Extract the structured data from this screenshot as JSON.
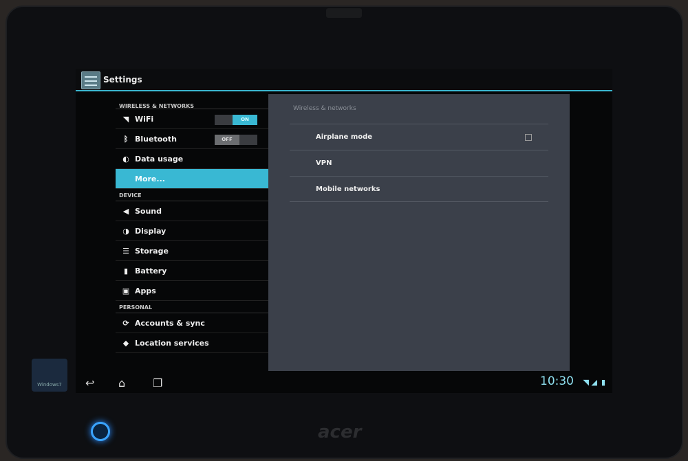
{
  "device": {
    "brand": "acer",
    "desktop_tile": "Windows7"
  },
  "action_bar": {
    "title": "Settings"
  },
  "left_pane": {
    "sections": [
      {
        "header": "WIRELESS & NETWORKS",
        "items": [
          {
            "label": "WiFi",
            "icon": "wifi-icon",
            "toggle": "ON"
          },
          {
            "label": "Bluetooth",
            "icon": "bluetooth-icon",
            "toggle": "OFF"
          },
          {
            "label": "Data usage",
            "icon": "data-usage-icon"
          },
          {
            "label": "More...",
            "selected": true
          }
        ]
      },
      {
        "header": "DEVICE",
        "items": [
          {
            "label": "Sound",
            "icon": "sound-icon"
          },
          {
            "label": "Display",
            "icon": "display-icon"
          },
          {
            "label": "Storage",
            "icon": "storage-icon"
          },
          {
            "label": "Battery",
            "icon": "battery-icon"
          },
          {
            "label": "Apps",
            "icon": "apps-icon"
          }
        ]
      },
      {
        "header": "PERSONAL",
        "items": [
          {
            "label": "Accounts & sync",
            "icon": "sync-icon"
          },
          {
            "label": "Location services",
            "icon": "location-icon"
          }
        ]
      }
    ]
  },
  "right_pane": {
    "header": "Wireless & networks",
    "items": [
      {
        "label": "Airplane mode",
        "checked": false
      },
      {
        "label": "VPN"
      },
      {
        "label": "Mobile networks"
      }
    ]
  },
  "system_bar": {
    "time": "10:30"
  },
  "colors": {
    "accent": "#39b8d3",
    "pane": "#3b404a"
  }
}
